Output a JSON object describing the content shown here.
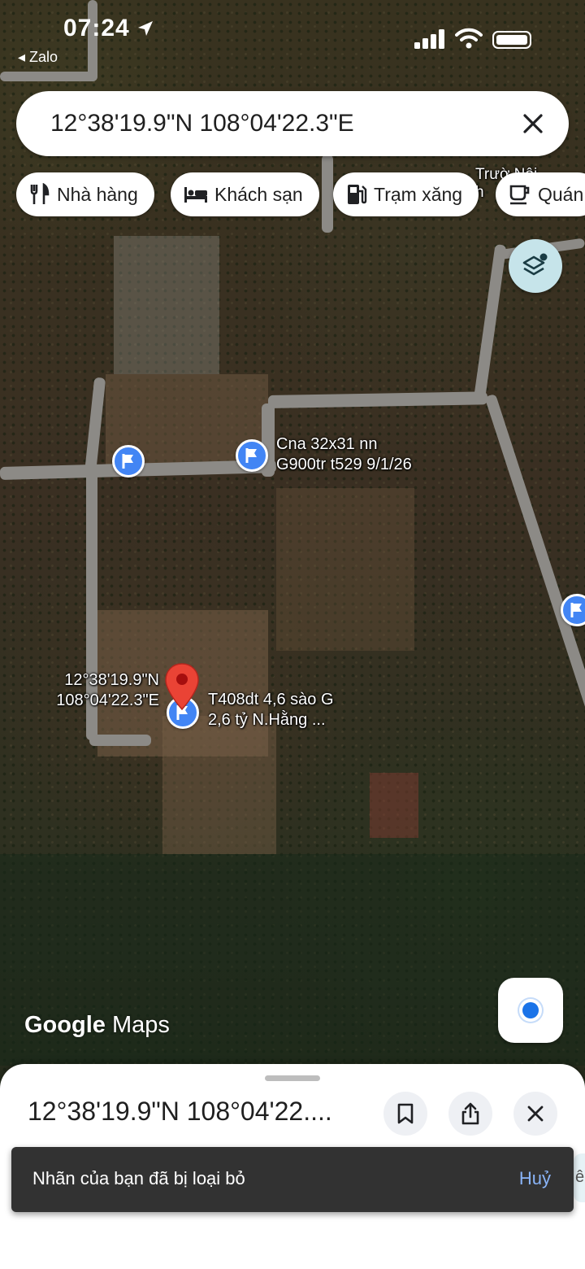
{
  "status_bar": {
    "time": "07:24",
    "back_app": "◂ Zalo"
  },
  "search": {
    "query": "12°38'19.9\"N 108°04'22.3\"E"
  },
  "chips": [
    {
      "label": "Nhà hàng",
      "icon": "restaurant-icon"
    },
    {
      "label": "Khách sạn",
      "icon": "hotel-icon"
    },
    {
      "label": "Trạm xăng",
      "icon": "gas-station-icon"
    },
    {
      "label": "Quán",
      "icon": "coffee-icon"
    }
  ],
  "map": {
    "label_cna_line1": "Cna 32x31 nn",
    "label_cna_line2": "G900tr t529 9/1/26",
    "label_coord_line1": "12°38'19.9\"N",
    "label_coord_line2": "108°04'22.3\"E",
    "label_t408_line1": "T408dt 4,6 sào G",
    "label_t408_line2": "2,6 tỷ N.Hằng ...",
    "logo_google": "Google",
    "logo_maps": "Maps",
    "partial_label_top": "Trườ   Nội",
    "partial_label_top2": "h"
  },
  "bottom_sheet": {
    "title": "12°38'19.9\"N 108°04'22...."
  },
  "snackbar": {
    "text": "Nhãn của bạn đã bị loại bỏ",
    "action": "Huỷ",
    "peek": "ên"
  },
  "colors": {
    "pin_blue": "#4285f4",
    "pin_red": "#ea4335",
    "snackbar_bg": "#323232",
    "snackbar_action": "#8ab4f8"
  }
}
